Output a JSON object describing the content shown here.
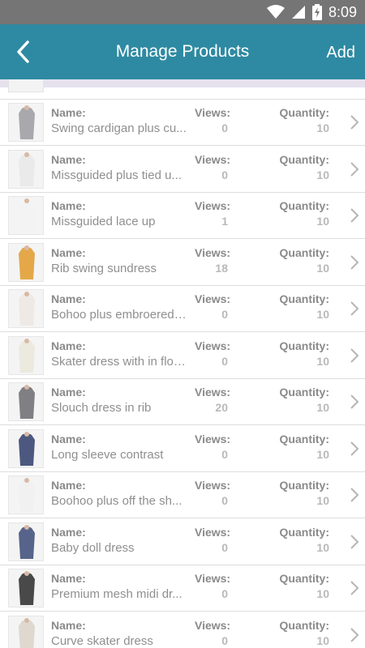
{
  "status_bar": {
    "time": "8:09"
  },
  "header": {
    "title": "Manage Products",
    "add_label": "Add"
  },
  "labels": {
    "name": "Name:",
    "views": "Views:",
    "quantity": "Quantity:"
  },
  "products": [
    {
      "name": "Swing cardigan plus cu...",
      "views": "0",
      "quantity": "10",
      "thumb_color": "#9a9aa0"
    },
    {
      "name": "Missguided plus tied u...",
      "views": "0",
      "quantity": "10",
      "thumb_color": "#e8e8e8"
    },
    {
      "name": "Missguided lace up",
      "views": "1",
      "quantity": "10",
      "thumb_color": "#f2f2f2"
    },
    {
      "name": "Rib swing sundress",
      "views": "18",
      "quantity": "10",
      "thumb_color": "#e19a2a"
    },
    {
      "name": "Bohoo plus embroered ...",
      "views": "0",
      "quantity": "10",
      "thumb_color": "#ece6e2"
    },
    {
      "name": "Skater dress with in flor...",
      "views": "0",
      "quantity": "10",
      "thumb_color": "#eae6da"
    },
    {
      "name": "Slouch dress in rib",
      "views": "20",
      "quantity": "10",
      "thumb_color": "#6a6a70"
    },
    {
      "name": "Long sleeve contrast",
      "views": "0",
      "quantity": "10",
      "thumb_color": "#2e3c6a"
    },
    {
      "name": "Boohoo plus off the sh...",
      "views": "0",
      "quantity": "10",
      "thumb_color": "#f0f0f0"
    },
    {
      "name": "Baby doll dress",
      "views": "0",
      "quantity": "10",
      "thumb_color": "#3a4a78"
    },
    {
      "name": "Premium mesh midi dr...",
      "views": "0",
      "quantity": "10",
      "thumb_color": "#2a2a2a"
    },
    {
      "name": "Curve skater dress",
      "views": "0",
      "quantity": "10",
      "thumb_color": "#d9d2c8"
    }
  ],
  "colors": {
    "app_bar": "#2e8aa2",
    "status_bar": "#757575",
    "divider": "#dddddd"
  },
  "icons": {
    "back": "chevron-left-icon",
    "row_chevron": "chevron-right-icon",
    "wifi": "wifi-icon",
    "signal": "signal-icon",
    "battery": "battery-charging-icon"
  }
}
